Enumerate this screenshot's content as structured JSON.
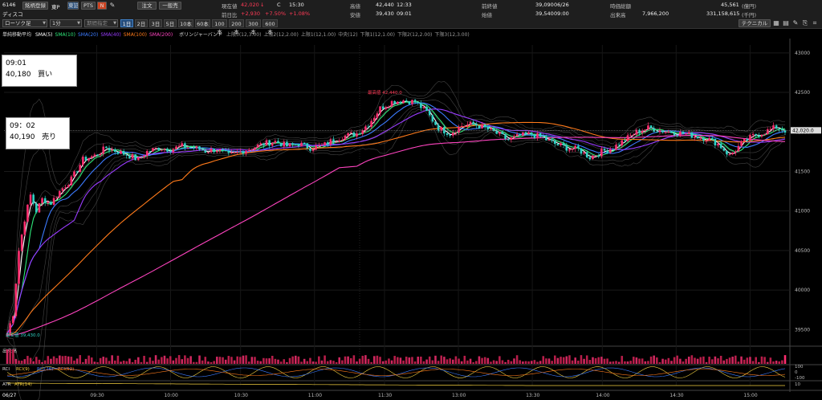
{
  "header": {
    "code": "6146",
    "name": "ディスコ",
    "menu_button": "銘柄登録",
    "market": "東P",
    "market2": "東証",
    "pts": "PTS",
    "n_icon": "N",
    "board_button": "注文",
    "detail_button": "一般売",
    "tools": [
      "▦",
      "▤",
      "✎",
      "⎘",
      "⌗",
      "⚙",
      "⊞",
      "⊟",
      "⊠",
      "⊡"
    ],
    "chart_type": "ローソク足",
    "interval": "1分",
    "period_select": "期間指定",
    "timeframes": [
      "1日",
      "2日",
      "3日",
      "5日",
      "10本",
      "60本",
      "100本",
      "200本",
      "300本",
      "600本"
    ],
    "active_timeframe": 0,
    "technical_button": "テクニカル",
    "quote": {
      "price_label": "現在値",
      "price": "42,020",
      "arrow": "↓",
      "mark": "C",
      "time": "15:30",
      "change_label": "前日比",
      "change": "+2,930",
      "change_pct": "+7.50%",
      "change_pct2": "+1.08%",
      "high_label": "高値",
      "high": "42,440",
      "high_time": "12:33",
      "low_label": "安値",
      "low": "39,430",
      "low_time": "09:01",
      "prev_close_label": "前終値",
      "prev_close": "39,090",
      "prev_date": "06/26",
      "open_label": "始値",
      "open": "39,540",
      "open_time": "09:00",
      "mktcap_label": "時価総額",
      "mktcap": "45,561",
      "mktcap_unit": "(億円)",
      "volume_label": "出来高",
      "volume": "7,966,200",
      "turnover": "331,158,615",
      "turnover_unit": "(千円)"
    }
  },
  "legend": {
    "title": "単純移動平均",
    "items": [
      {
        "label": "SMA(5)",
        "color": "#ffffff"
      },
      {
        "label": "SMA(10)",
        "color": "#2ee87a"
      },
      {
        "label": "SMA(20)",
        "color": "#3c7bff"
      },
      {
        "label": "SMA(40)",
        "color": "#9a3cff"
      },
      {
        "label": "SMA(100)",
        "color": "#ff7a1a"
      },
      {
        "label": "SMA(200)",
        "color": "#ff44c0"
      }
    ],
    "bb_title": "ボリンジャーバンド",
    "bb_items": [
      "上限3(12,3.00)",
      "上限2(12,2.00)",
      "上限1(12,1.00)",
      "中央(12)",
      "下限1(12,1.00)",
      "下限2(12,2.00)",
      "下限3(12,3.00)"
    ]
  },
  "callouts": {
    "buy": {
      "time": "09:01",
      "price": "40,180",
      "side": "買い"
    },
    "sell": {
      "time": "09：02",
      "price": "40,190",
      "side": "売り"
    }
  },
  "chart_data": {
    "type": "candlestick",
    "title": "",
    "y_ticks": [
      "43000",
      "42500",
      "42000",
      "41500",
      "41000",
      "40500",
      "40000",
      "39500"
    ],
    "x_ticks": [
      "06/27",
      "09:30",
      "10:00",
      "10:30",
      "11:00",
      "11:30",
      "13:00",
      "13:30",
      "14:00",
      "14:30",
      "15:00"
    ],
    "ylim": [
      39300,
      43100
    ],
    "current_price_label": "42,020.0",
    "high_annotation": "最高値 42,440.0",
    "low_annotation": "最安値 39,430.0",
    "price_path": [
      [
        0,
        39450
      ],
      [
        2,
        39700
      ],
      [
        4,
        40500
      ],
      [
        6,
        40900
      ],
      [
        8,
        41200
      ],
      [
        10,
        41000
      ],
      [
        12,
        41150
      ],
      [
        15,
        41100
      ],
      [
        18,
        41250
      ],
      [
        22,
        41400
      ],
      [
        26,
        41650
      ],
      [
        30,
        41700
      ],
      [
        34,
        41800
      ],
      [
        38,
        41750
      ],
      [
        42,
        41700
      ],
      [
        45,
        41650
      ],
      [
        48,
        41750
      ],
      [
        52,
        41800
      ],
      [
        56,
        41780
      ],
      [
        60,
        41820
      ],
      [
        64,
        41800
      ],
      [
        68,
        41760
      ],
      [
        72,
        41780
      ],
      [
        76,
        41700
      ],
      [
        80,
        41750
      ],
      [
        84,
        41800
      ],
      [
        88,
        41850
      ],
      [
        92,
        41880
      ],
      [
        96,
        41820
      ],
      [
        100,
        41850
      ],
      [
        104,
        41800
      ],
      [
        108,
        41820
      ],
      [
        112,
        41900
      ],
      [
        116,
        41950
      ],
      [
        120,
        41980
      ],
      [
        124,
        42100
      ],
      [
        128,
        42300
      ],
      [
        132,
        42380
      ],
      [
        136,
        42400
      ],
      [
        140,
        42380
      ],
      [
        144,
        42250
      ],
      [
        148,
        42050
      ],
      [
        152,
        41980
      ],
      [
        156,
        42080
      ],
      [
        160,
        42100
      ],
      [
        164,
        42050
      ],
      [
        168,
        41980
      ],
      [
        172,
        41900
      ],
      [
        176,
        41950
      ],
      [
        180,
        41970
      ],
      [
        184,
        41920
      ],
      [
        188,
        41850
      ],
      [
        192,
        41800
      ],
      [
        196,
        41780
      ],
      [
        200,
        41680
      ],
      [
        204,
        41750
      ],
      [
        208,
        41800
      ],
      [
        212,
        41900
      ],
      [
        216,
        42000
      ],
      [
        220,
        42050
      ],
      [
        224,
        42020
      ],
      [
        228,
        42000
      ],
      [
        232,
        41980
      ],
      [
        236,
        41950
      ],
      [
        240,
        41920
      ],
      [
        244,
        41850
      ],
      [
        248,
        41700
      ],
      [
        252,
        41850
      ],
      [
        256,
        41950
      ],
      [
        260,
        42000
      ],
      [
        264,
        42060
      ],
      [
        267,
        42020
      ]
    ],
    "series": [
      {
        "name": "SMA(5)",
        "color": "#ffffff",
        "smooth": 3
      },
      {
        "name": "SMA(10)",
        "color": "#2ee87a",
        "smooth": 6
      },
      {
        "name": "SMA(20)",
        "color": "#3c7bff",
        "smooth": 12
      },
      {
        "name": "SMA(40)",
        "color": "#9a3cff",
        "smooth": 24
      },
      {
        "name": "SMA(100)",
        "color": "#ff7a1a",
        "smooth": 60
      },
      {
        "name": "SMA(200)",
        "color": "#ff44c0",
        "smooth": 120
      }
    ],
    "sub_panels": [
      {
        "label": "出来高"
      },
      {
        "label": "RCI",
        "items": [
          "RCI(9)",
          "RCI(26)",
          "RCI(52)"
        ],
        "ticks": [
          "100",
          "0",
          "-100"
        ]
      },
      {
        "label": "ATR",
        "items": [
          "ATR(14)"
        ],
        "ticks": [
          "10"
        ]
      }
    ]
  }
}
